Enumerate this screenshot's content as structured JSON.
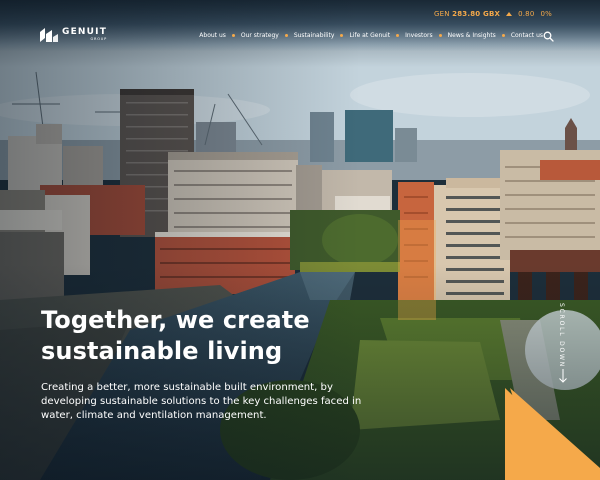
{
  "colors": {
    "accent": "#f5a94a",
    "text": "#ffffff",
    "dark": "#1d2e3a"
  },
  "stock": {
    "symbol": "GEN",
    "price": "283.80 GBX",
    "change": "0.80",
    "change_pct": "0%"
  },
  "brand": {
    "name": "GENUIT",
    "sub": "GROUP"
  },
  "nav": {
    "items": [
      "About us",
      "Our strategy",
      "Sustainability",
      "Life at Genuit",
      "Investors",
      "News & Insights",
      "Contact us"
    ]
  },
  "icons": {
    "search": "search-icon",
    "logo": "genuit-logo-icon",
    "scroll": "arrow-down-icon"
  },
  "hero": {
    "title_line1": "Together, we create",
    "title_line2": "sustainable living",
    "body": "Creating a better, more sustainable built environment, by developing sustainable solutions to the key challenges faced in water, climate and ventilation management.",
    "scroll_label": "SCROLL DOWN"
  }
}
